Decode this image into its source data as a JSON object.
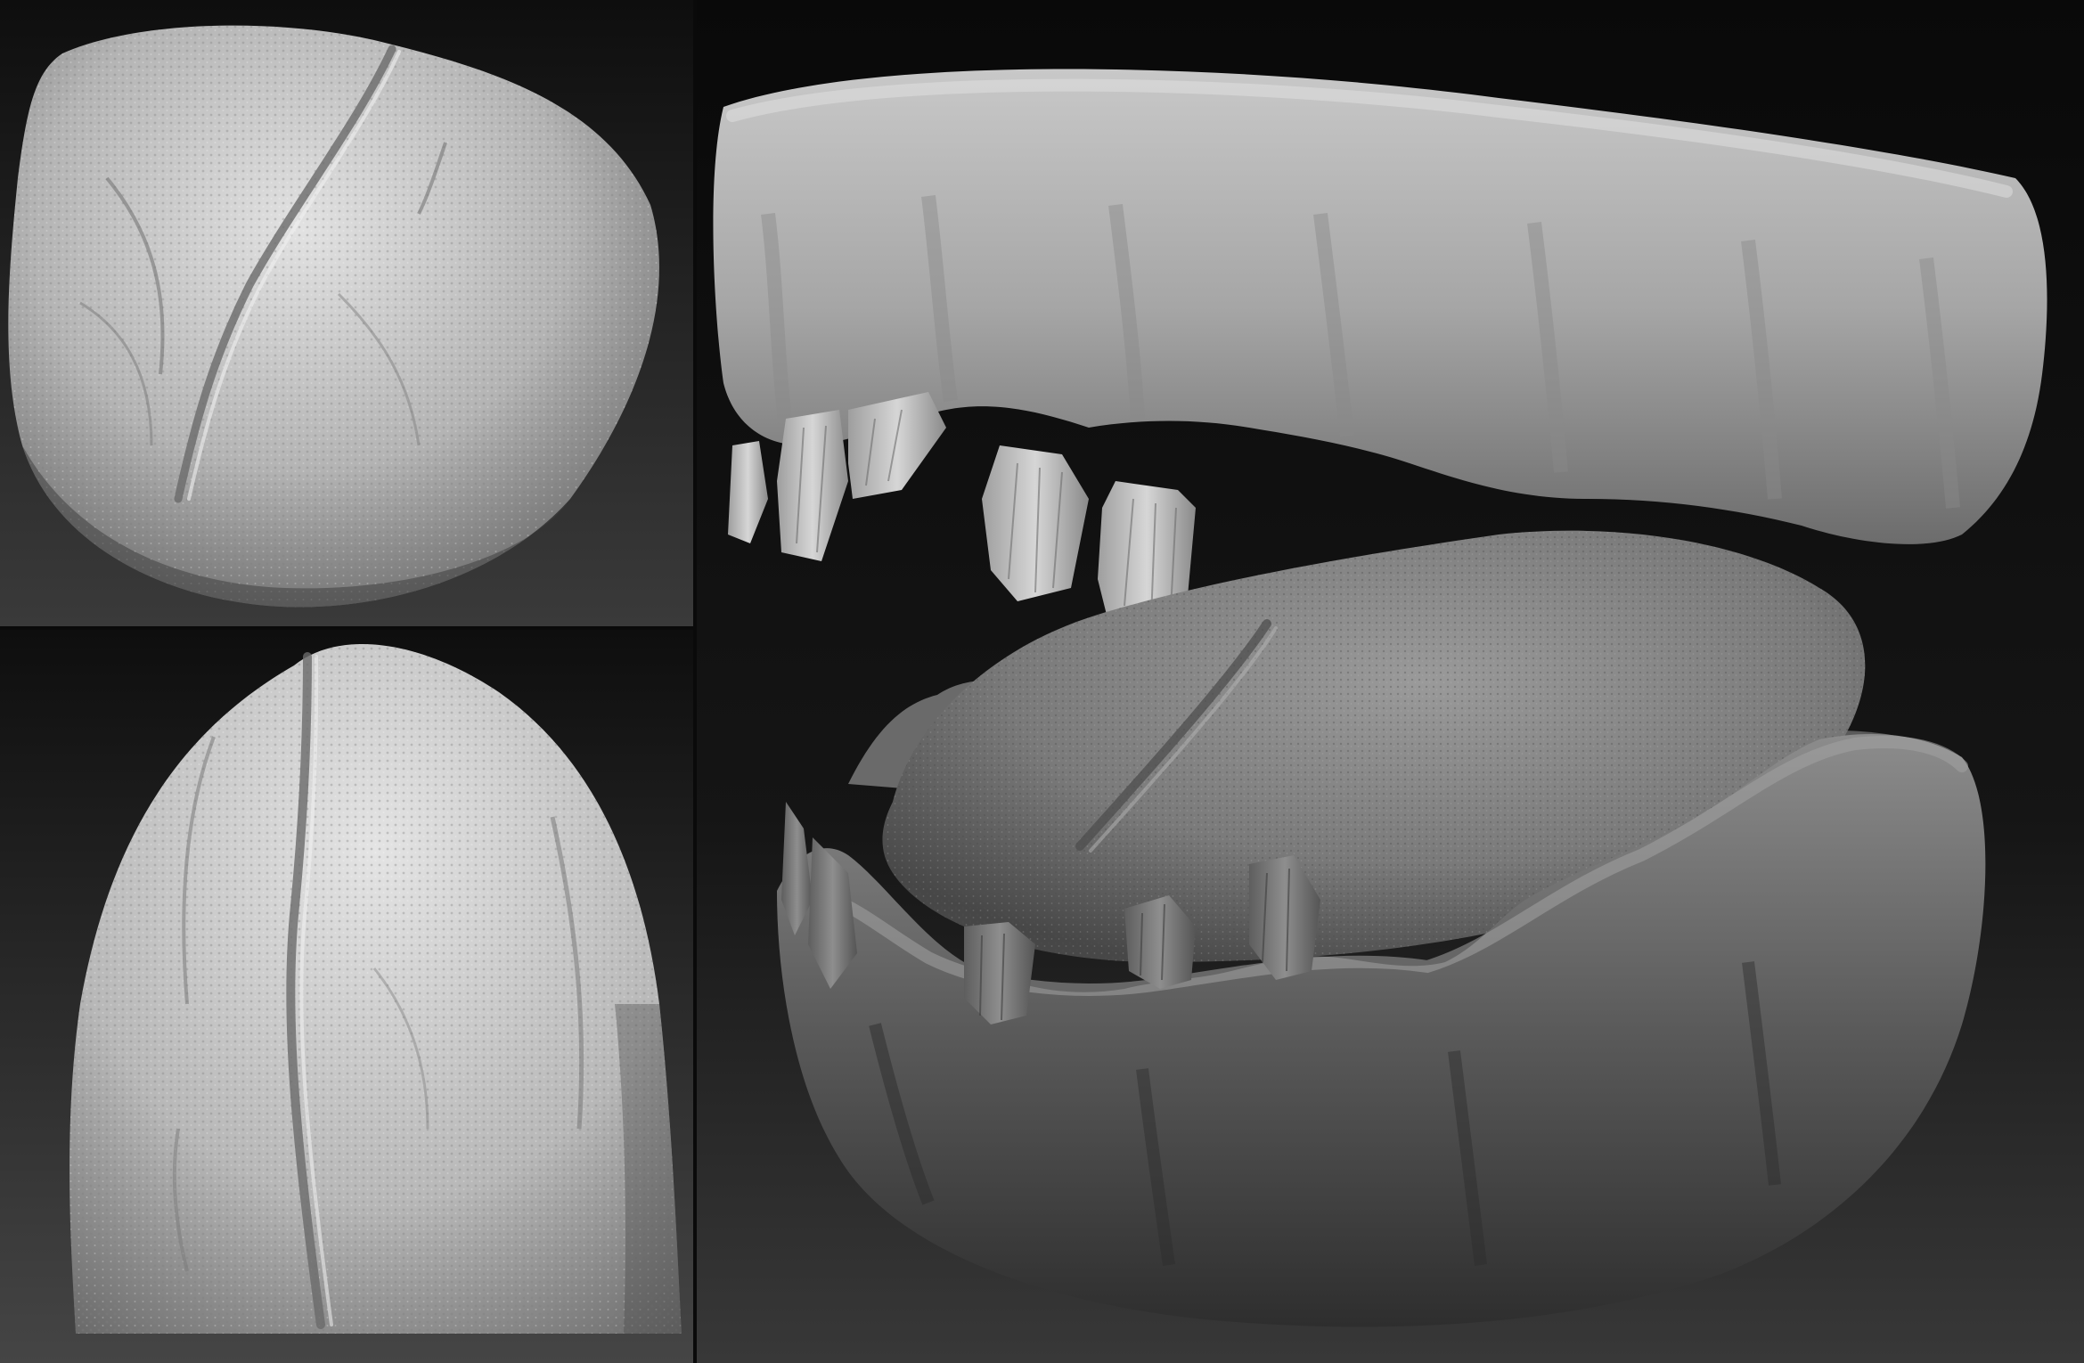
{
  "colors": {
    "background_top": "#0d0d0d",
    "background_bottom": "#3c3c3c",
    "clay_light": "#dcdcdc",
    "clay_mid": "#9a9a9a",
    "clay_dark": "#4a4a4a"
  },
  "panels": [
    {
      "id": "top-left",
      "subject": "tongue-oblique-view"
    },
    {
      "id": "bottom-left",
      "subject": "tongue-top-view"
    },
    {
      "id": "right",
      "subject": "jaw-with-teeth-and-tongue"
    }
  ]
}
